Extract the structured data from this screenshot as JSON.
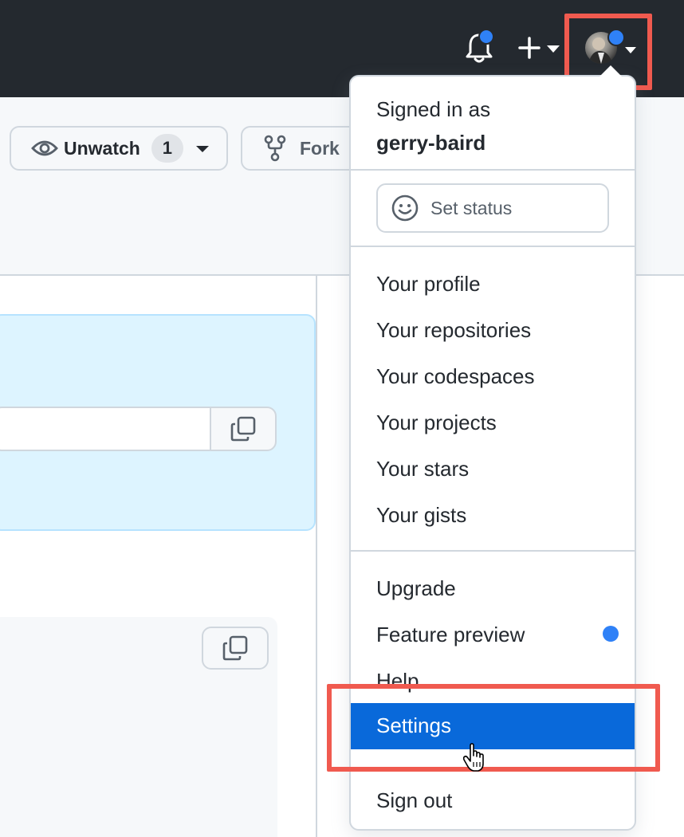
{
  "header": {
    "notification_icon": "bell-icon",
    "create_icon": "plus-icon",
    "avatar_alt": "user avatar"
  },
  "repo_actions": {
    "unwatch_label": "Unwatch",
    "unwatch_count": "1",
    "fork_label": "Fork"
  },
  "user_menu": {
    "signed_in_label": "Signed in as",
    "username": "gerry-baird",
    "set_status_label": "Set status",
    "items_primary": [
      "Your profile",
      "Your repositories",
      "Your codespaces",
      "Your projects",
      "Your stars",
      "Your gists"
    ],
    "items_secondary": [
      "Upgrade",
      "Feature preview",
      "Help"
    ],
    "settings_label": "Settings",
    "sign_out_label": "Sign out"
  },
  "colors": {
    "header_bg": "#24292f",
    "accent_blue": "#2f81f7",
    "selected_bg": "#0969da",
    "highlight_red": "#f05a4f"
  }
}
